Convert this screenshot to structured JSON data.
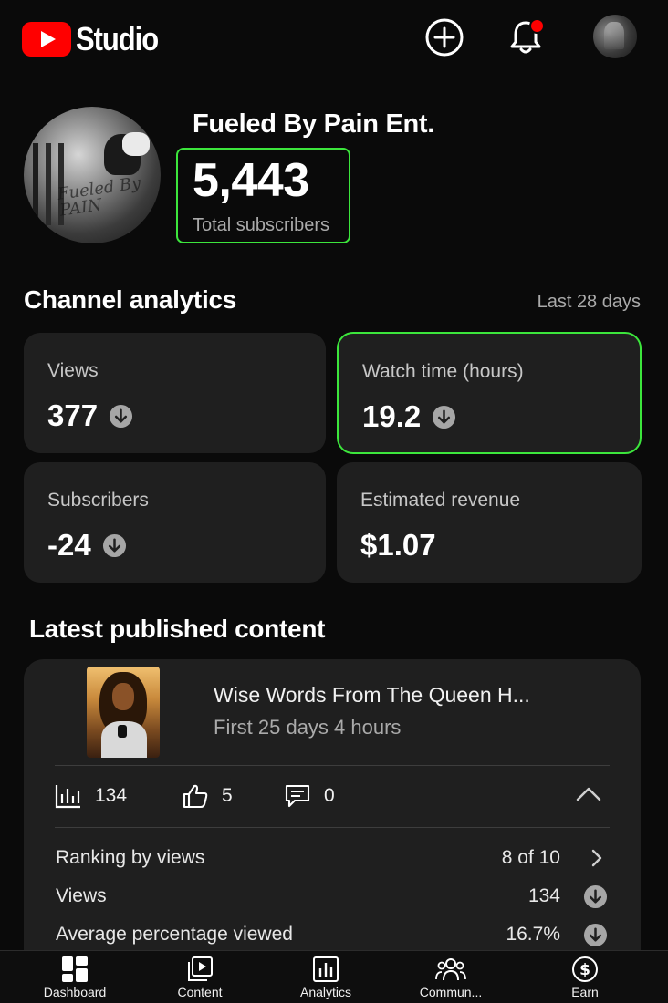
{
  "header": {
    "app_name": "Studio",
    "icons": [
      "youtube-logo-icon",
      "create-icon",
      "notifications-icon",
      "account-avatar"
    ]
  },
  "channel": {
    "name": "Fueled By Pain Ent.",
    "avatar_text": "Fueled By PAIN",
    "subscribers": "5,443",
    "subscribers_label": "Total subscribers"
  },
  "analytics": {
    "title": "Channel analytics",
    "period": "Last 28 days",
    "cards": [
      {
        "label": "Views",
        "value": "377",
        "trend": "down"
      },
      {
        "label": "Watch time (hours)",
        "value": "19.2",
        "trend": "down"
      },
      {
        "label": "Subscribers",
        "value": "-24",
        "trend": "down"
      },
      {
        "label": "Estimated revenue",
        "value": "$1.07"
      }
    ]
  },
  "latest": {
    "title": "Latest published content",
    "video_title": "Wise Words From The Queen H...",
    "video_subtitle": "First 25 days 4 hours",
    "stats": {
      "views": "134",
      "likes": "5",
      "comments": "0"
    },
    "rows": [
      {
        "label": "Ranking by views",
        "value": "8 of 10",
        "icon": "chevron-right-icon"
      },
      {
        "label": "Views",
        "value": "134",
        "icon": "arrow-down-icon"
      },
      {
        "label": "Average percentage viewed",
        "value": "16.7%",
        "icon": "arrow-down-icon"
      }
    ]
  },
  "nav": [
    {
      "label": "Dashboard",
      "icon": "dashboard-icon"
    },
    {
      "label": "Content",
      "icon": "content-icon"
    },
    {
      "label": "Analytics",
      "icon": "analytics-icon"
    },
    {
      "label": "Commun...",
      "icon": "community-icon"
    },
    {
      "label": "Earn",
      "icon": "earn-icon"
    }
  ],
  "colors": {
    "background": "#0a0a0a",
    "card": "#1f1f1f",
    "highlight": "#3ce63c",
    "brand_red": "#ff0000",
    "secondary_text": "#aaaaaa"
  }
}
